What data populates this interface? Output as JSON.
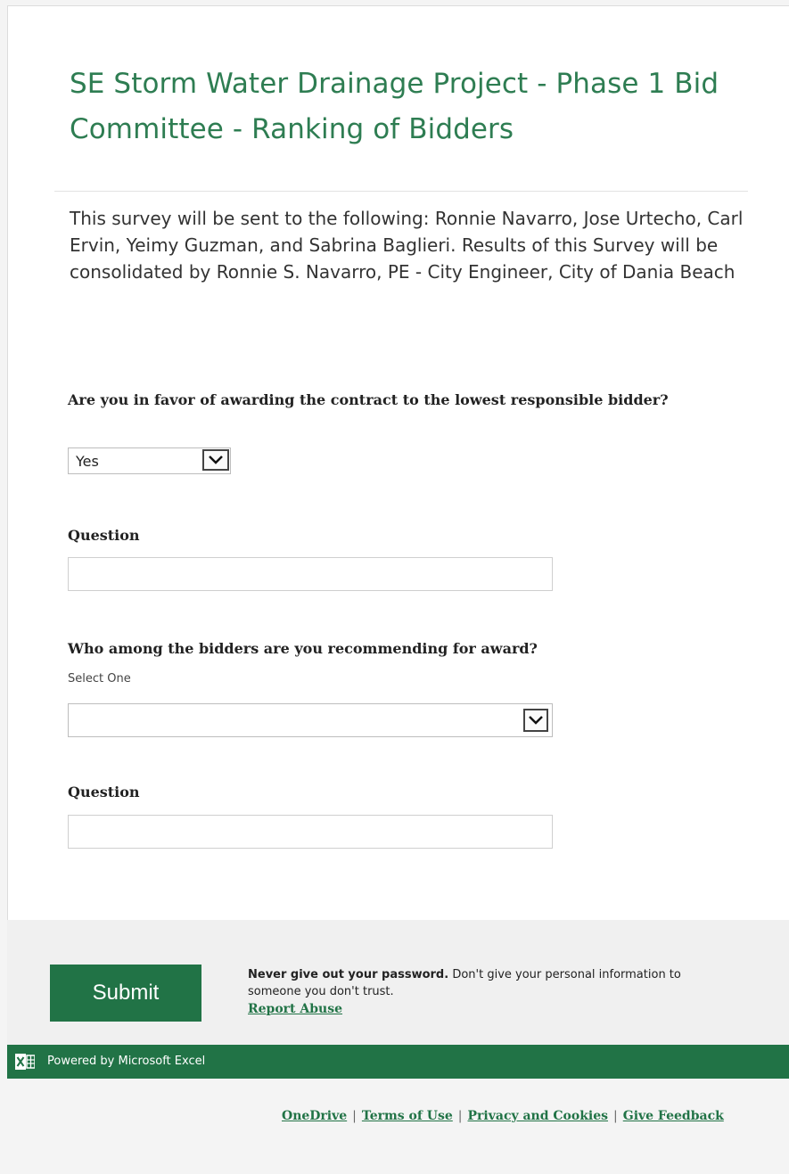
{
  "survey": {
    "title": "SE Storm Water Drainage Project - Phase 1 Bid Committee - Ranking of Bidders",
    "description": "This survey will be sent to the following: Ronnie Navarro, Jose Urtecho, Carl Ervin, Yeimy Guzman, and Sabrina Baglieri. Results of this Survey will be consolidated by Ronnie S. Navarro, PE - City Engineer, City of Dania Beach"
  },
  "questions": [
    {
      "label": "Are you in favor of awarding the contract to the lowest responsible bidder?",
      "selected": "Yes"
    },
    {
      "label": "Question",
      "value": "",
      "placeholder": ""
    },
    {
      "label": "Who among the bidders are you recommending for award?",
      "hint": "Select One",
      "selected": ""
    },
    {
      "label": "Question",
      "value": "",
      "placeholder": ""
    }
  ],
  "footer": {
    "submit_label": "Submit",
    "notice_bold": "Never give out your password.",
    "notice_text": " Don't give your personal information to someone you don't trust.",
    "report_abuse": "Report Abuse",
    "powered_by": "Powered by Microsoft Excel",
    "links": [
      "OneDrive",
      "Terms of Use",
      "Privacy and Cookies",
      "Give Feedback"
    ],
    "separator": "|"
  },
  "colors": {
    "title": "#2e7d52",
    "accent": "#217346"
  },
  "icons": {
    "excel": "excel-icon",
    "dropdown": "chevron-down-icon"
  }
}
